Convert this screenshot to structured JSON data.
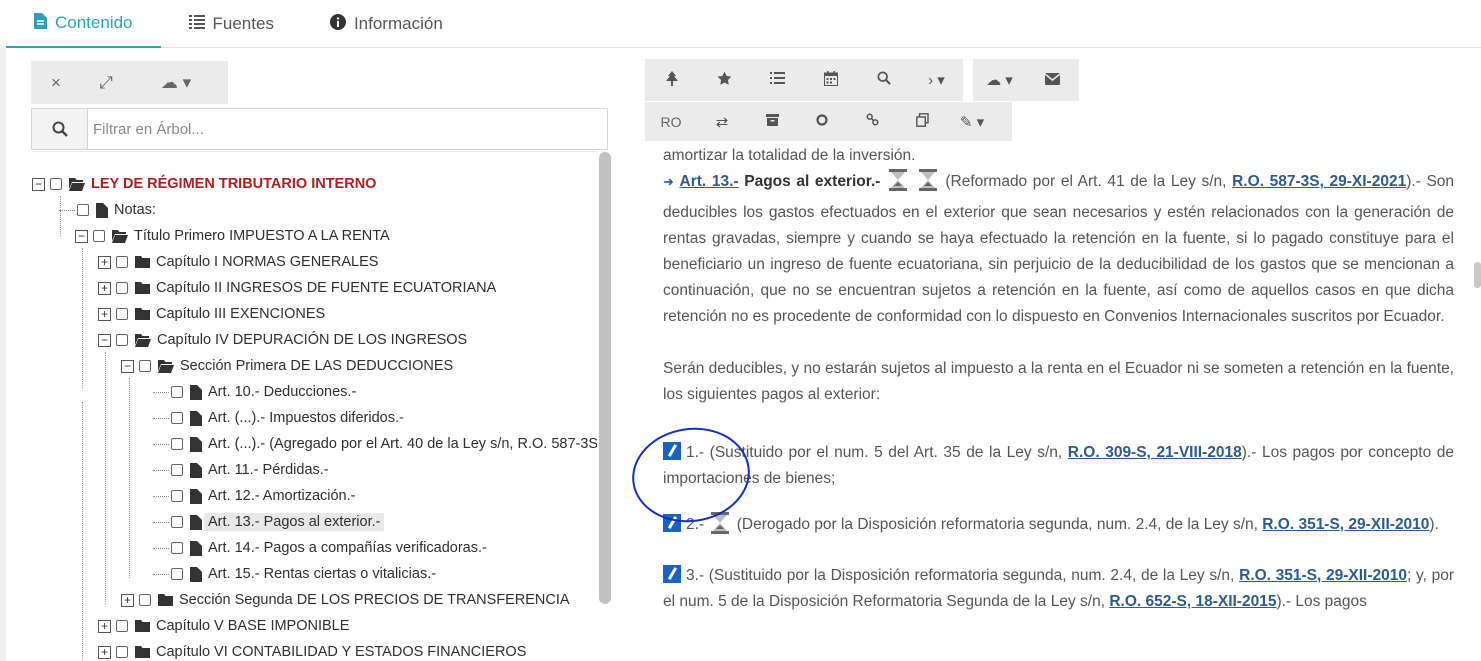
{
  "tabs": [
    {
      "label": "Contenido",
      "icon": "file-icon",
      "active": true
    },
    {
      "label": "Fuentes",
      "icon": "list-icon"
    },
    {
      "label": "Información",
      "icon": "info-icon"
    }
  ],
  "left_toolbar": {
    "close_icon": "×",
    "expand_icon": "⤢",
    "cloud_icon": "☁ ▾"
  },
  "filter": {
    "placeholder": "Filtrar en Árbol..."
  },
  "tree": [
    {
      "label": "LEY DE RÉGIMEN TRIBUTARIO INTERNO"
    },
    {
      "label": "Notas:"
    },
    {
      "label": "Título Primero IMPUESTO A LA RENTA"
    },
    {
      "label": "Capítulo I NORMAS GENERALES"
    },
    {
      "label": "Capítulo II INGRESOS DE FUENTE ECUATORIANA"
    },
    {
      "label": "Capítulo III EXENCIONES"
    },
    {
      "label": "Capítulo IV DEPURACIÓN DE LOS INGRESOS"
    },
    {
      "label": "Sección Primera DE LAS DEDUCCIONES"
    },
    {
      "label": "Art. 10.- Deducciones.-"
    },
    {
      "label": "Art. (...).- Impuestos diferidos.-"
    },
    {
      "label": "Art. (...).- (Agregado por el Art. 40 de la Ley s/n, R.O. 587-3S"
    },
    {
      "label": "Art. 11.- Pérdidas.-"
    },
    {
      "label": "Art. 12.- Amortización.-"
    },
    {
      "label": "Art. 13.- Pagos al exterior.-"
    },
    {
      "label": "Art. 14.- Pagos a compañías verificadoras.-"
    },
    {
      "label": "Art. 15.- Rentas ciertas o vitalicias.-"
    },
    {
      "label": "Sección Segunda DE LOS PRECIOS DE TRANSFERENCIA"
    },
    {
      "label": "Capítulo V BASE IMPONIBLE"
    },
    {
      "label": "Capítulo VI CONTABILIDAD Y ESTADOS FINANCIEROS"
    }
  ],
  "right_toolbar": {
    "ro_label": "RO"
  },
  "content": {
    "p0": "amortizar la totalidad de la inversión.",
    "art_link": "Art. 13.-",
    "art_title": "Pagos al exterior.-",
    "p1_pre": "(Reformado por el Art. 41 de la Ley s/n, ",
    "p1_link": "R.O. 587-3S, 29-XI-2021",
    "p1_post": ").- Son deducibles los gastos efectuados en el exterior que sean necesarios y estén relacionados con la generación de rentas gravadas, siempre y cuando se haya efectuado la retención en la fuente, si lo pagado constituye para el beneficiario un ingreso de fuente ecuatoriana, sin perjuicio de la deducibilidad de los gastos que se mencionan a continuación, que no se encuentran sujetos a retención en la fuente, así como de aquellos casos en que dicha retención no es procedente de conformidad con lo dispuesto en Convenios Internacionales suscritos por Ecuador.",
    "p2": "Serán deducibles, y no estarán sujetos al impuesto a la renta en el Ecuador ni se someten a retención en la fuente, los siguientes pagos al exterior:",
    "i1_pre": "1.- (Sustituido por el num. 5 del Art. 35 de la Ley s/n, ",
    "i1_link": "R.O. 309-S, 21-VIII-2018",
    "i1_post": ").- Los pagos por concepto de importaciones de bienes;",
    "i2_pre": "2.- ",
    "i2_mid": " (Derogado por la Disposición reformatoria segunda, num. 2.4, de la Ley s/n, ",
    "i2_link": "R.O. 351-S, 29-XII-2010",
    "i2_post": ").",
    "i3_pre": "3.- (Sustituido por la Disposición reformatoria segunda, num. 2.4, de la Ley s/n, ",
    "i3_link1": "R.O. 351-S, 29-XII-2010",
    "i3_mid": "; y, por el num. 5 de la Disposición Reformatoria Segunda de la Ley s/n, ",
    "i3_link2": "R.O. 652-S, 18-XII-2015",
    "i3_post": ").- Los pagos"
  },
  "colors": {
    "accent": "#27a7b8",
    "link": "#2d5b8e",
    "root_label": "#b11e1e",
    "annotation": "#1530b8"
  }
}
